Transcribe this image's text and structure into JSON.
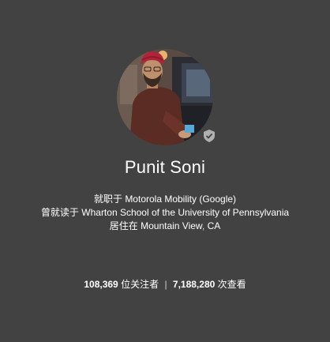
{
  "profile": {
    "name": "Punit Soni",
    "verified_icon": "verified-shield-icon",
    "work_prefix": "就职于",
    "work_value": "Motorola Mobility (Google)",
    "education_prefix": "曾就读于",
    "education_value": "Wharton School of the University of Pennsylvania",
    "location_prefix": "居住在",
    "location_value": "Mountain View, CA"
  },
  "stats": {
    "followers_count": "108,369",
    "followers_label": "位关注者",
    "separator": "|",
    "views_count": "7,188,280",
    "views_label": "次查看"
  },
  "colors": {
    "background": "#424242",
    "text": "#ffffff",
    "badge": "#b0b0b0"
  }
}
